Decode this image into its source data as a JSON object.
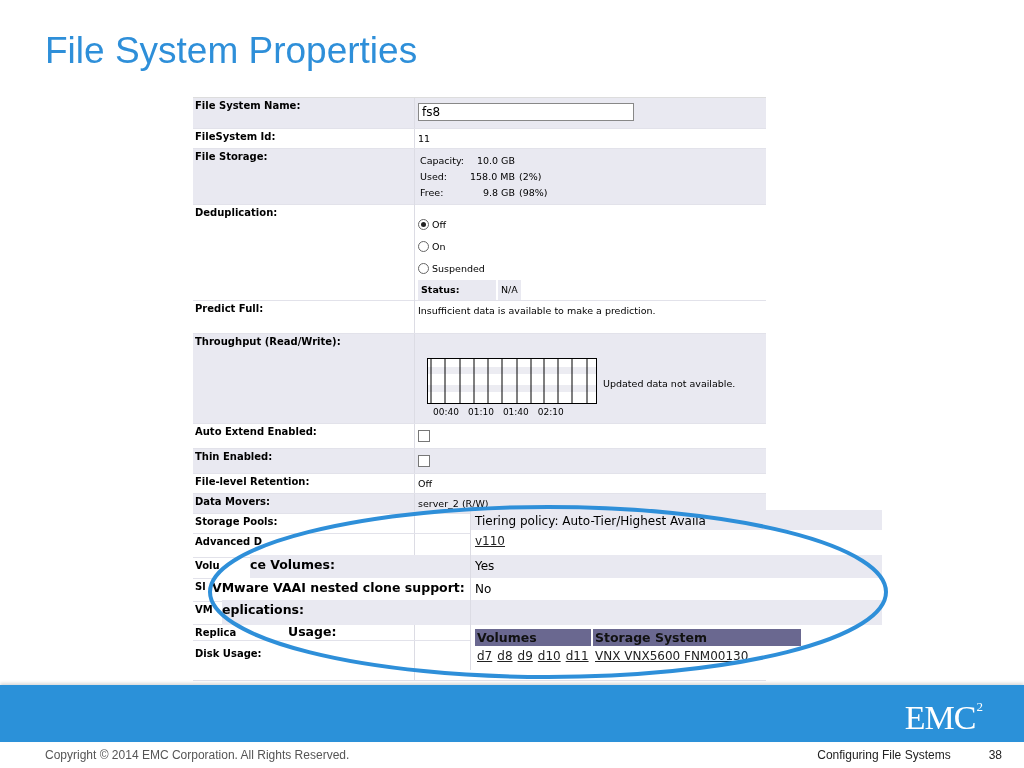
{
  "slide": {
    "title": "File System Properties"
  },
  "properties": {
    "rows": [
      {
        "kind": "field",
        "label": "File System Name:",
        "value": "fs8"
      },
      {
        "kind": "text",
        "label": "FileSystem Id:",
        "value": "11"
      },
      {
        "kind": "storage",
        "label": "File Storage:",
        "lines": [
          {
            "name": "Capacity:",
            "amount": "10.0 GB"
          },
          {
            "name": "Used:",
            "amount": "158.0 MB",
            "share": "(2%)"
          },
          {
            "name": "Free:",
            "amount": "9.8 GB",
            "share": "(98%)"
          }
        ]
      },
      {
        "kind": "radio",
        "label": "Deduplication:",
        "options": [
          {
            "label": "Off",
            "selected": true
          },
          {
            "label": "On",
            "selected": false
          },
          {
            "label": "Suspended",
            "selected": false
          }
        ],
        "status_label": "Status:",
        "status_value": "N/A"
      },
      {
        "kind": "text",
        "label": "Predict Full:",
        "value": "Insufficient data is available to make a prediction."
      },
      {
        "kind": "chart",
        "label": "Throughput (Read/Write):",
        "time_labels": [
          "00:40",
          "01:10",
          "01:40",
          "02:10"
        ],
        "note": "Updated data not available."
      },
      {
        "kind": "checkbox",
        "label": "Auto Extend Enabled:",
        "checked": false
      },
      {
        "kind": "checkbox",
        "label": "Thin Enabled:",
        "checked": false
      },
      {
        "kind": "text",
        "label": "File-level Retention:",
        "value": "Off"
      },
      {
        "kind": "text",
        "label": "Data Movers:",
        "value": "server_2 (R/W)"
      },
      {
        "kind": "text",
        "label": "Storage Pools:"
      },
      {
        "kind": "text",
        "label": "Advanced D"
      },
      {
        "kind": "text",
        "label": "Volu"
      },
      {
        "kind": "text",
        "label": "Sl"
      },
      {
        "kind": "text",
        "label": "VM"
      },
      {
        "kind": "text",
        "label": "Replica"
      },
      {
        "kind": "text",
        "label": "Disk Usage:"
      }
    ]
  },
  "callout": {
    "rows": [
      {
        "kind": "text",
        "value": "Tiering policy: Auto-Tier/Highest Availa"
      },
      {
        "kind": "link",
        "value": "v110"
      },
      {
        "kind": "text",
        "label": "ce Volumes:",
        "value": "Yes"
      },
      {
        "kind": "text",
        "label": "VMware VAAI nested clone support:",
        "value": "No"
      },
      {
        "kind": "text",
        "label": "eplications:"
      },
      {
        "kind": "table",
        "label": "Usage:",
        "columns": [
          "Volumes",
          "Storage System"
        ],
        "volume_links": [
          "d7",
          "d8",
          "d9",
          "d10",
          "d11"
        ],
        "system_link": "VNX VNX5600 FNM00130"
      }
    ]
  },
  "logo": {
    "text": "EMC",
    "superscript": "2"
  },
  "footer": {
    "copyright": "Copyright © 2014 EMC Corporation. All Rights Reserved.",
    "section": "Configuring File Systems",
    "page": "38"
  }
}
